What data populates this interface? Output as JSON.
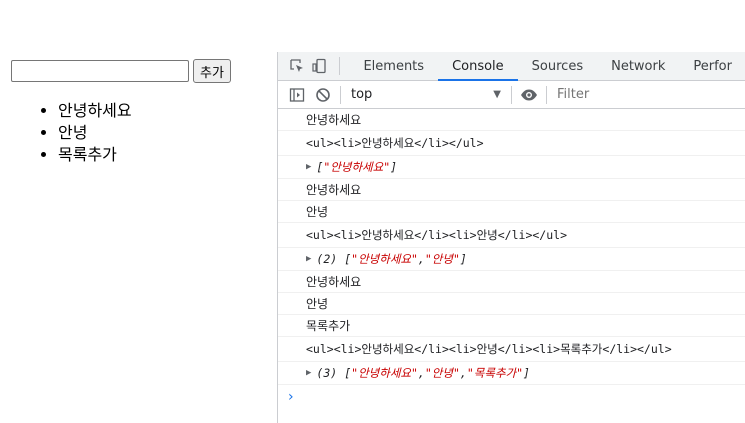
{
  "page": {
    "input_value": "",
    "add_button_label": "추가",
    "list_items": [
      "안녕하세요",
      "안녕",
      "목록추가"
    ]
  },
  "devtools": {
    "tabs": [
      "Elements",
      "Console",
      "Sources",
      "Network",
      "Perfor"
    ],
    "active_tab": "Console",
    "toolbar": {
      "context": "top",
      "filter_placeholder": "Filter"
    },
    "console": {
      "messages": [
        {
          "kind": "text",
          "text": "안녕하세요"
        },
        {
          "kind": "mono",
          "text": "<ul><li>안녕하세요</li></ul>"
        },
        {
          "kind": "array",
          "count": "",
          "items": [
            "안녕하세요"
          ]
        },
        {
          "kind": "text",
          "text": "안녕하세요"
        },
        {
          "kind": "text",
          "text": "안녕"
        },
        {
          "kind": "mono",
          "text": "<ul><li>안녕하세요</li><li>안녕</li></ul>"
        },
        {
          "kind": "array",
          "count": "(2)",
          "items": [
            "안녕하세요",
            "안녕"
          ]
        },
        {
          "kind": "text",
          "text": "안녕하세요"
        },
        {
          "kind": "text",
          "text": "안녕"
        },
        {
          "kind": "text",
          "text": "목록추가"
        },
        {
          "kind": "mono",
          "text": "<ul><li>안녕하세요</li><li>안녕</li><li>목록추가</li></ul>"
        },
        {
          "kind": "array",
          "count": "(3)",
          "items": [
            "안녕하세요",
            "안녕",
            "목록추가"
          ]
        }
      ],
      "prompt": "›"
    },
    "colors": {
      "accent": "#1a73e8",
      "string": "#c80000",
      "border": "#cbcdd1",
      "tabbar_bg": "#f1f3f4"
    }
  }
}
